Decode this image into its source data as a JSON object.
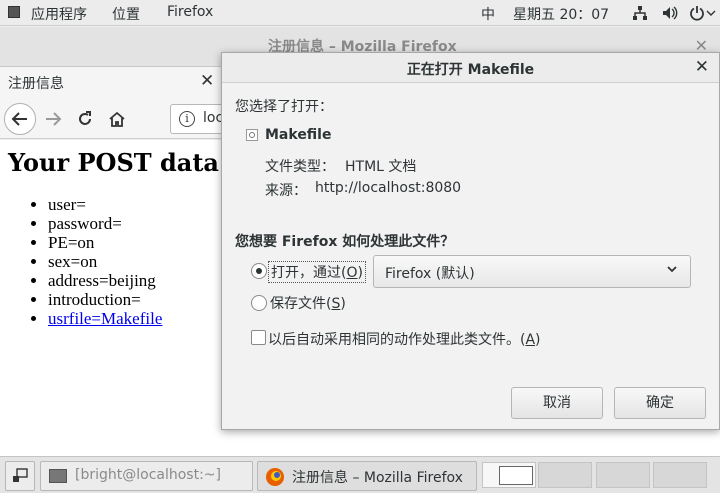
{
  "topbar": {
    "apps": "应用程序",
    "places": "位置",
    "firefox": "Firefox",
    "input_method": "中",
    "clock": "星期五 20：07"
  },
  "firefox_window": {
    "title": "注册信息 – Mozilla Firefox",
    "tab_label": "注册信息",
    "url": "localhost"
  },
  "page": {
    "heading": "Your POST data",
    "items": [
      "user=",
      "password=",
      "PE=on",
      "sex=on",
      "address=beijing",
      "introduction="
    ],
    "link": "usrfile=Makefile"
  },
  "dialog": {
    "title": "正在打开 Makefile",
    "chosen_label": "您选择了打开：",
    "file_name": "Makefile",
    "file_type_label": "文件类型：",
    "file_type": "HTML 文档",
    "source_label": "来源：",
    "source": "http://localhost:8080",
    "question": "您想要 Firefox 如何处理此文件？",
    "open_with_label": "打开，通过",
    "open_with_key": "O",
    "open_with_app": "Firefox (默认)",
    "save_label": "保存文件",
    "save_key": "S",
    "auto_label": "以后自动采用相同的动作处理此类文件。",
    "auto_key": "A",
    "cancel": "取消",
    "ok": "确定",
    "open_with_selected": true,
    "auto_checked": false
  },
  "taskbar": {
    "terminal": "[bright@localhost:~]",
    "firefox": "注册信息 – Mozilla Firefox"
  }
}
